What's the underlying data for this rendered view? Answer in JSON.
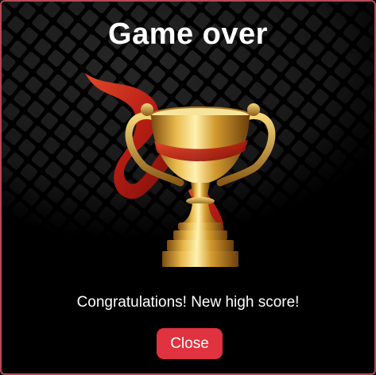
{
  "dialog": {
    "title": "Game over",
    "message": "Congratulations! New high score!",
    "close_label": "Close"
  },
  "icons": {
    "trophy": "trophy-icon"
  },
  "colors": {
    "background": "#000000",
    "border": "#b74a57",
    "button": "#e0323f",
    "text": "#ffffff",
    "gold": "#d8a23a",
    "ribbon": "#c8261c"
  }
}
